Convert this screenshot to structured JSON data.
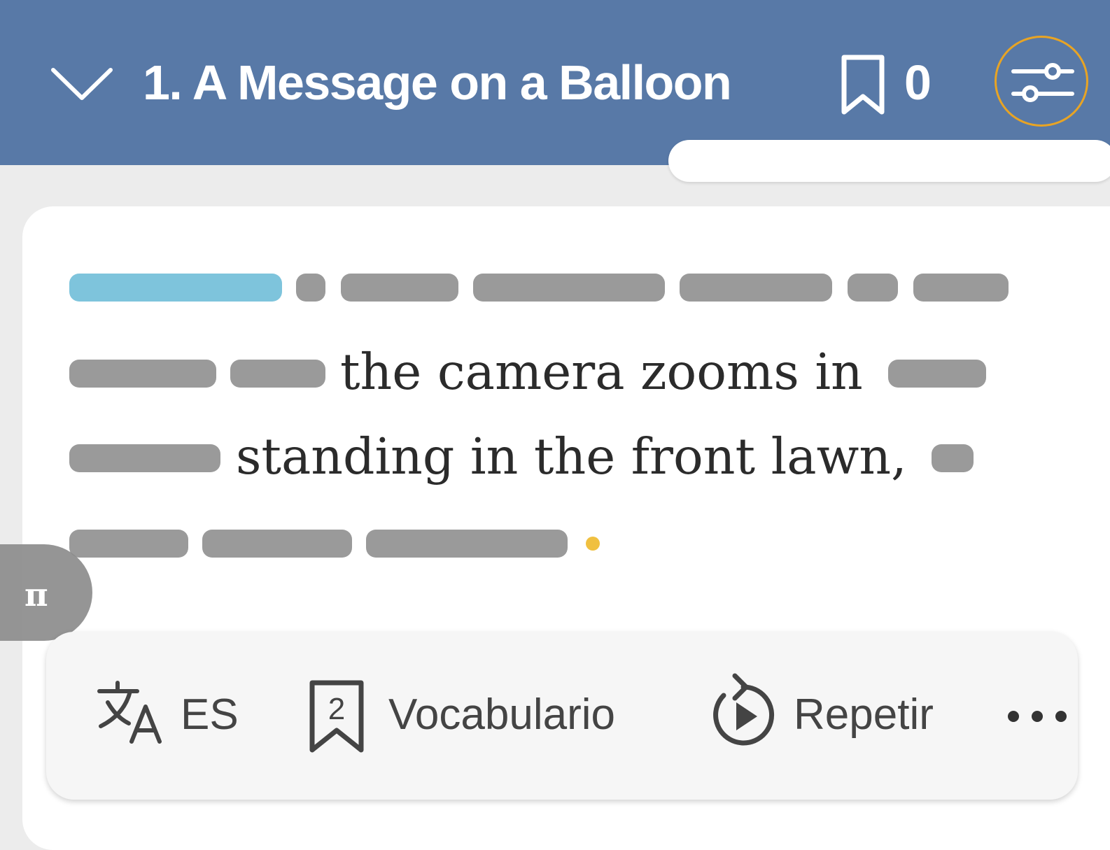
{
  "header": {
    "title": "1. A Message on a Balloon",
    "bookmark_count": "0",
    "background_color": "#5879a7",
    "icons": [
      "chevron-down-icon",
      "bookmark-icon",
      "sliders-icon"
    ]
  },
  "reader": {
    "line2_text": "the camera zooms in",
    "line3_text": "standing in the front lawn,"
  },
  "toolbar": {
    "translate_label": "ES",
    "vocabulary_label": "Vocabulario",
    "vocabulary_count": "2",
    "repeat_label": "Repetir",
    "more_label": "•••"
  },
  "side_tab": {
    "symbol": "π"
  },
  "colors": {
    "active_word": "#7ec4dc",
    "hidden_word": "#9a9a9a",
    "dot": "#f0c040",
    "focus_ring": "#e8a424"
  }
}
